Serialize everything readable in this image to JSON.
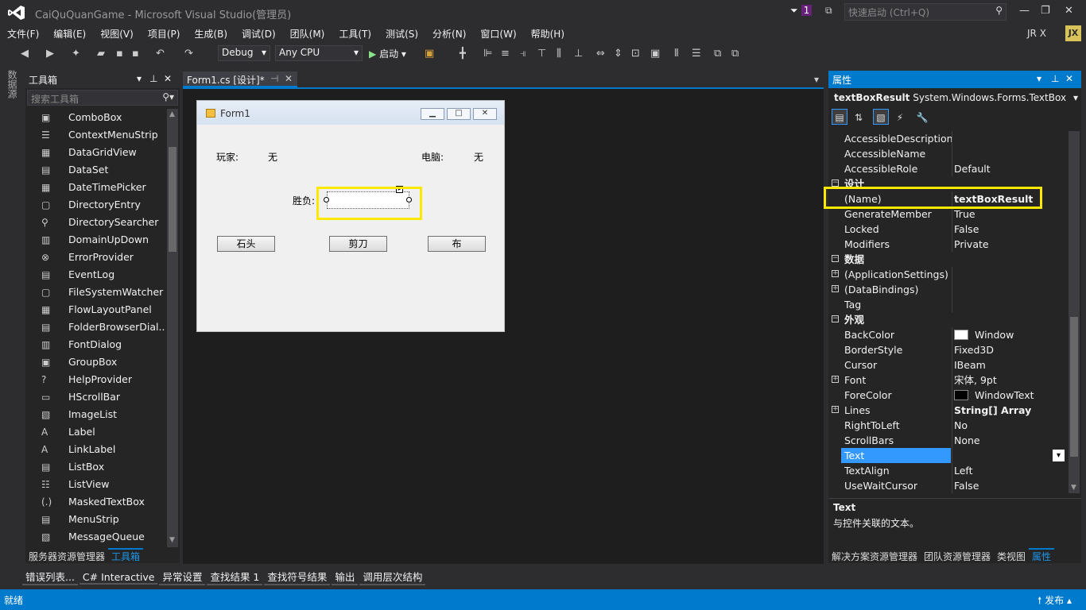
{
  "window": {
    "title": "CaiQuQuanGame - Microsoft Visual Studio(管理员)",
    "notif_count": "1",
    "quick_launch": "快速启动 (Ctrl+Q)",
    "user": "JR X",
    "avatar": "JX"
  },
  "menu": [
    "文件(F)",
    "编辑(E)",
    "视图(V)",
    "项目(P)",
    "生成(B)",
    "调试(D)",
    "团队(M)",
    "工具(T)",
    "测试(S)",
    "分析(N)",
    "窗口(W)",
    "帮助(H)"
  ],
  "toolbar": {
    "config": "Debug",
    "platform": "Any CPU",
    "start": "启动"
  },
  "left_vertical_tab": "数据源",
  "toolbox": {
    "title": "工具箱",
    "search": "搜索工具箱",
    "items": [
      {
        "icon": "▣",
        "label": "ComboBox"
      },
      {
        "icon": "☰",
        "label": "ContextMenuStrip"
      },
      {
        "icon": "▦",
        "label": "DataGridView"
      },
      {
        "icon": "▤",
        "label": "DataSet"
      },
      {
        "icon": "▦",
        "label": "DateTimePicker"
      },
      {
        "icon": "▢",
        "label": "DirectoryEntry"
      },
      {
        "icon": "⚲",
        "label": "DirectorySearcher"
      },
      {
        "icon": "▥",
        "label": "DomainUpDown"
      },
      {
        "icon": "⊗",
        "label": "ErrorProvider"
      },
      {
        "icon": "▤",
        "label": "EventLog"
      },
      {
        "icon": "▢",
        "label": "FileSystemWatcher"
      },
      {
        "icon": "▦",
        "label": "FlowLayoutPanel"
      },
      {
        "icon": "▤",
        "label": "FolderBrowserDial..."
      },
      {
        "icon": "▥",
        "label": "FontDialog"
      },
      {
        "icon": "▣",
        "label": "GroupBox"
      },
      {
        "icon": "?",
        "label": "HelpProvider"
      },
      {
        "icon": "▭",
        "label": "HScrollBar"
      },
      {
        "icon": "▧",
        "label": "ImageList"
      },
      {
        "icon": "A",
        "label": "Label"
      },
      {
        "icon": "A",
        "label": "LinkLabel"
      },
      {
        "icon": "▤",
        "label": "ListBox"
      },
      {
        "icon": "☷",
        "label": "ListView"
      },
      {
        "icon": "(.)",
        "label": "MaskedTextBox"
      },
      {
        "icon": "▤",
        "label": "MenuStrip"
      },
      {
        "icon": "▧",
        "label": "MessageQueue"
      }
    ],
    "footer_tabs": [
      "服务器资源管理器",
      "工具箱"
    ]
  },
  "document": {
    "tab": "Form1.cs [设计]*"
  },
  "form": {
    "title": "Form1",
    "player_label": "玩家:",
    "player_value": "无",
    "computer_label": "电脑:",
    "computer_value": "无",
    "result_label": "胜负:",
    "buttons": [
      "石头",
      "剪刀",
      "布"
    ]
  },
  "properties": {
    "title": "属性",
    "object_name": "textBoxResult",
    "object_type": "System.Windows.Forms.TextBox",
    "rows": [
      {
        "name": "AccessibleDescription",
        "value": ""
      },
      {
        "name": "AccessibleName",
        "value": ""
      },
      {
        "name": "AccessibleRole",
        "value": "Default"
      },
      {
        "name": "设计",
        "category": true
      },
      {
        "name": "(Name)",
        "value": "textBoxResult",
        "bold": true
      },
      {
        "name": "GenerateMember",
        "value": "True"
      },
      {
        "name": "Locked",
        "value": "False"
      },
      {
        "name": "Modifiers",
        "value": "Private"
      },
      {
        "name": "数据",
        "category": true
      },
      {
        "name": "(ApplicationSettings)",
        "value": "",
        "expand": true
      },
      {
        "name": "(DataBindings)",
        "value": "",
        "expand": true
      },
      {
        "name": "Tag",
        "value": ""
      },
      {
        "name": "外观",
        "category": true
      },
      {
        "name": "BackColor",
        "value": "Window",
        "swatch": "#ffffff"
      },
      {
        "name": "BorderStyle",
        "value": "Fixed3D"
      },
      {
        "name": "Cursor",
        "value": "IBeam"
      },
      {
        "name": "Font",
        "value": "宋体, 9pt",
        "expand": true
      },
      {
        "name": "ForeColor",
        "value": "WindowText",
        "swatch": "#000000"
      },
      {
        "name": "Lines",
        "value": "String[] Array",
        "expand": true,
        "bold": true
      },
      {
        "name": "RightToLeft",
        "value": "No"
      },
      {
        "name": "ScrollBars",
        "value": "None"
      },
      {
        "name": "Text",
        "value": "",
        "selected": true
      },
      {
        "name": "TextAlign",
        "value": "Left"
      },
      {
        "name": "UseWaitCursor",
        "value": "False"
      }
    ],
    "desc_title": "Text",
    "desc_text": "与控件关联的文本。",
    "footer_tabs": [
      "解决方案资源管理器",
      "团队资源管理器",
      "类视图",
      "属性"
    ]
  },
  "bottom_tabs": [
    "错误列表...",
    "C# Interactive",
    "异常设置",
    "查找结果 1",
    "查找符号结果",
    "输出",
    "调用层次结构"
  ],
  "status": {
    "left": "就绪",
    "right": "发布"
  },
  "colors": {
    "accent": "#007acc",
    "highlight": "#ffe800",
    "background": "#2d2d30"
  }
}
